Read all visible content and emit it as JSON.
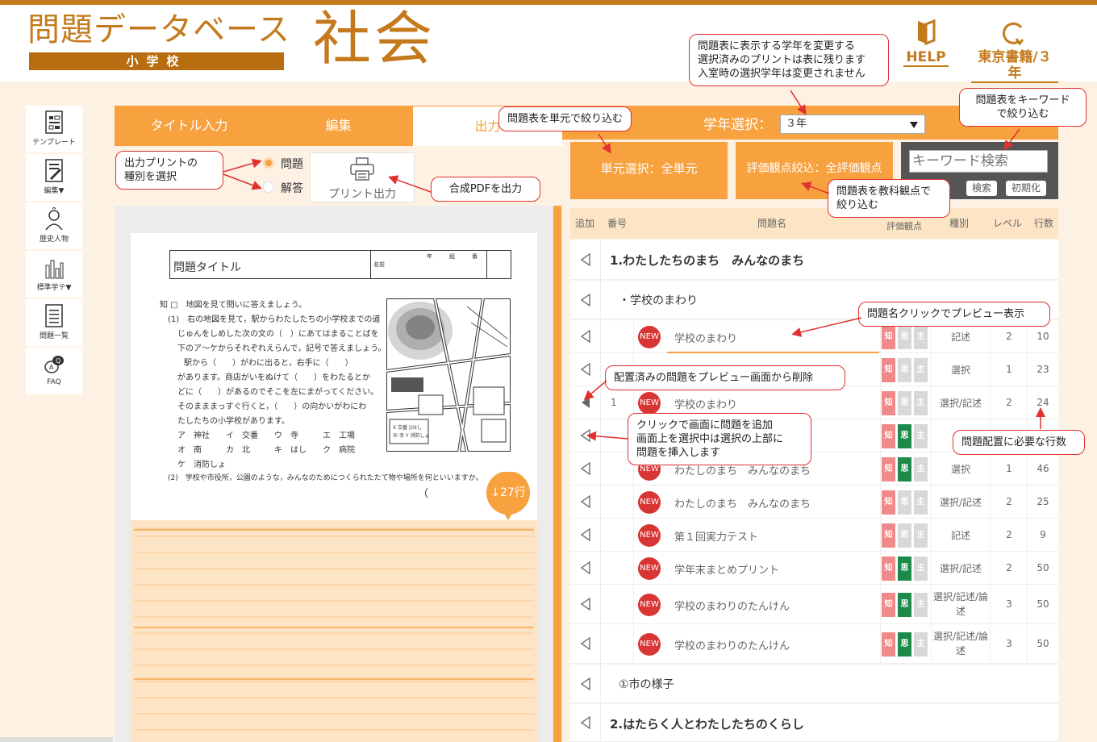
{
  "header": {
    "logo_main": "問題データベース",
    "logo_sub": "小学校",
    "subject": "社会",
    "help_label": "HELP",
    "textbook_label": "東京書籍/３年"
  },
  "sidebar": {
    "items": [
      {
        "label": "テンプレート"
      },
      {
        "label": "編集▼"
      },
      {
        "label": "歴史人物"
      },
      {
        "label": "標準学テ▼"
      },
      {
        "label": "問題一覧"
      },
      {
        "label": "FAQ"
      }
    ]
  },
  "tabs": {
    "title_input": "タイトル入力",
    "edit": "編集",
    "output": "出力"
  },
  "output_options": {
    "question_label": "問題",
    "answer_label": "解答",
    "print_label": "プリント出力"
  },
  "preview": {
    "title": "問題タイトル",
    "name_label": "名前",
    "grade_label": "年",
    "class_label": "組",
    "num_label": "番",
    "line_count_badge": "↓27行",
    "lines": [
      "知 □　地図を見て問いに答えましょう。",
      "(1)　右の地図を見て，駅からわたしたちの小学校までの道",
      "じゅんをしめした次の文の（　）にあてはまることばを",
      "下のア〜ケからそれぞれえらんで，記号で答えましょう。",
      "駅から（　　）がわに出ると，右手に（　　）",
      "があります。商店がいをぬけて（　　）をわたるとか",
      "どに（　　）があるのでそこを左にまがってください。",
      "そのまままっすぐ行くと，（　　）の向かいがわにわ",
      "たしたちの小学校があります。",
      "ア　神社　　イ　交番　　ウ　寺　　　エ　工場",
      "オ　南　　　カ　北　　　キ　はし　　ク　病院",
      "ケ　消防しょ",
      "(2)　学校や市役所，公園のような，みんなのためにつくられたたて物や場所を何といいますか。",
      "（"
    ]
  },
  "grade": {
    "label": "学年選択：",
    "value": "３年"
  },
  "filters": {
    "unit": "単元選択：全単元",
    "perspective": "評価観点絞込：全評価観点",
    "keyword_placeholder": "キーワード検索",
    "search_btn": "検索",
    "reset_btn": "初期化"
  },
  "table": {
    "headers": [
      "追加",
      "番号",
      "問題名",
      "評価観点",
      "種別",
      "レベル",
      "行数"
    ],
    "group1": "1.わたしたちのまち　みんなのまち",
    "sub1": "・学校のまわり",
    "rows": [
      {
        "num": "",
        "name": "学校のまわり",
        "badge": "NEW",
        "type": "記述",
        "level": "2",
        "lines": "10",
        "shi": false
      },
      {
        "num": "",
        "name": "",
        "badge": "",
        "type": "選択",
        "level": "1",
        "lines": "23",
        "shi": false
      },
      {
        "num": "1",
        "name": "学校のまわり",
        "badge": "NEW",
        "type": "選択/記述",
        "level": "2",
        "lines": "24",
        "shi": false
      },
      {
        "num": "",
        "name": "",
        "badge": "",
        "type": "選",
        "level": "",
        "lines": "",
        "shi": true
      },
      {
        "num": "",
        "name": "わたしのまち　みんなのまち",
        "badge": "NEW",
        "type": "選択",
        "level": "1",
        "lines": "46",
        "shi": true
      },
      {
        "num": "",
        "name": "わたしのまち　みんなのまち",
        "badge": "NEW",
        "type": "選択/記述",
        "level": "2",
        "lines": "25",
        "shi": false
      },
      {
        "num": "",
        "name": "第１回実力テスト",
        "badge": "NEW",
        "type": "記述",
        "level": "2",
        "lines": "9",
        "shi": false
      },
      {
        "num": "",
        "name": "学年末まとめプリント",
        "badge": "NEW",
        "type": "選択/記述",
        "level": "2",
        "lines": "50",
        "shi": true
      },
      {
        "num": "",
        "name": "学校のまわりのたんけん",
        "badge": "NEW",
        "type": "選択/記述/論述",
        "level": "3",
        "lines": "50",
        "shi": true
      },
      {
        "num": "",
        "name": "学校のまわりのたんけん",
        "badge": "NEW",
        "type": "選択/記述/論述",
        "level": "3",
        "lines": "50",
        "shi": true
      }
    ],
    "sub2": "①市の様子",
    "group2": "2.はたらく人とわたしたちのくらし",
    "perspective_chars": [
      "知",
      "思",
      "主"
    ]
  },
  "callouts": {
    "grade_note_1": "問題表に表示する学年を変更する",
    "grade_note_2": "選択済みのプリントは表に残ります",
    "grade_note_3": "入室時の選択学年は変更されません",
    "unit_note": "問題表を単元で絞り込む",
    "keyword_note_1": "問題表をキーワード",
    "keyword_note_2": "で絞り込む",
    "print_type_note_1": "出力プリントの",
    "print_type_note_2": "種別を選択",
    "pdf_note": "合成PDFを出力",
    "perspective_note_1": "問題表を教科観点で",
    "perspective_note_2": "絞り込む",
    "preview_note": "問題名クリックでプレビュー表示",
    "remove_note": "配置済みの問題をプレビュー画面から削除",
    "add_note_1": "クリックで画面に問題を追加",
    "add_note_2": "画面上を選択中は選択の上部に",
    "add_note_3": "問題を挿入します",
    "lines_note": "問題配置に必要な行数"
  },
  "colors": {
    "accent": "#f7a13f",
    "brand": "#c47a1c",
    "new_badge": "#d83535",
    "knowledge": "#f08a8a",
    "thinking": "#1d8a4a",
    "inactive": "#d8d8d8"
  }
}
